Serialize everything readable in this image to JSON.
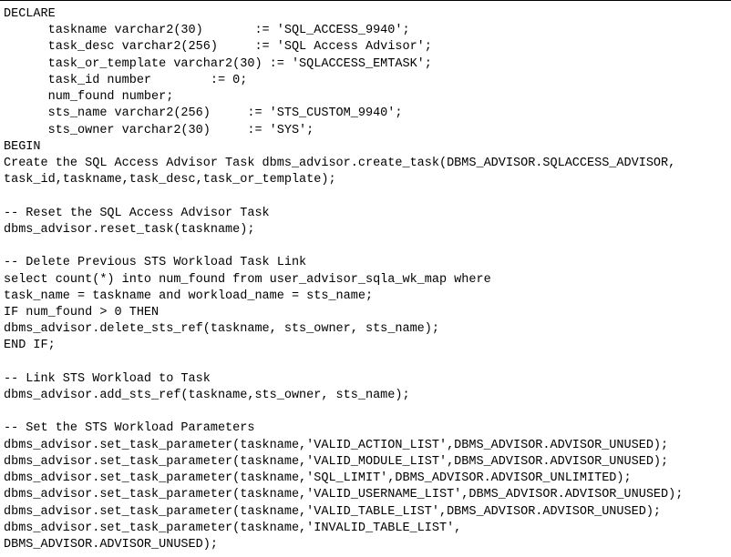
{
  "code": "DECLARE\n      taskname varchar2(30)       := 'SQL_ACCESS_9940';\n      task_desc varchar2(256)     := 'SQL Access Advisor';\n      task_or_template varchar2(30) := 'SQLACCESS_EMTASK';\n      task_id number        := 0;\n      num_found number;\n      sts_name varchar2(256)     := 'STS_CUSTOM_9940';\n      sts_owner varchar2(30)     := 'SYS';\nBEGIN\nCreate the SQL Access Advisor Task dbms_advisor.create_task(DBMS_ADVISOR.SQLACCESS_ADVISOR,\ntask_id,taskname,task_desc,task_or_template);\n\n-- Reset the SQL Access Advisor Task\ndbms_advisor.reset_task(taskname);\n\n-- Delete Previous STS Workload Task Link\nselect count(*) into num_found from user_advisor_sqla_wk_map where\ntask_name = taskname and workload_name = sts_name;\nIF num_found > 0 THEN\ndbms_advisor.delete_sts_ref(taskname, sts_owner, sts_name);\nEND IF;\n\n-- Link STS Workload to Task\ndbms_advisor.add_sts_ref(taskname,sts_owner, sts_name);\n\n-- Set the STS Workload Parameters\ndbms_advisor.set_task_parameter(taskname,'VALID_ACTION_LIST',DBMS_ADVISOR.ADVISOR_UNUSED);\ndbms_advisor.set_task_parameter(taskname,'VALID_MODULE_LIST',DBMS_ADVISOR.ADVISOR_UNUSED);\ndbms_advisor.set_task_parameter(taskname,'SQL_LIMIT',DBMS_ADVISOR.ADVISOR_UNLIMITED);\ndbms_advisor.set_task_parameter(taskname,'VALID_USERNAME_LIST',DBMS_ADVISOR.ADVISOR_UNUSED);\ndbms_advisor.set_task_parameter(taskname,'VALID_TABLE_LIST',DBMS_ADVISOR.ADVISOR_UNUSED);\ndbms_advisor.set_task_parameter(taskname,'INVALID_TABLE_LIST',\nDBMS_ADVISOR.ADVISOR_UNUSED);"
}
